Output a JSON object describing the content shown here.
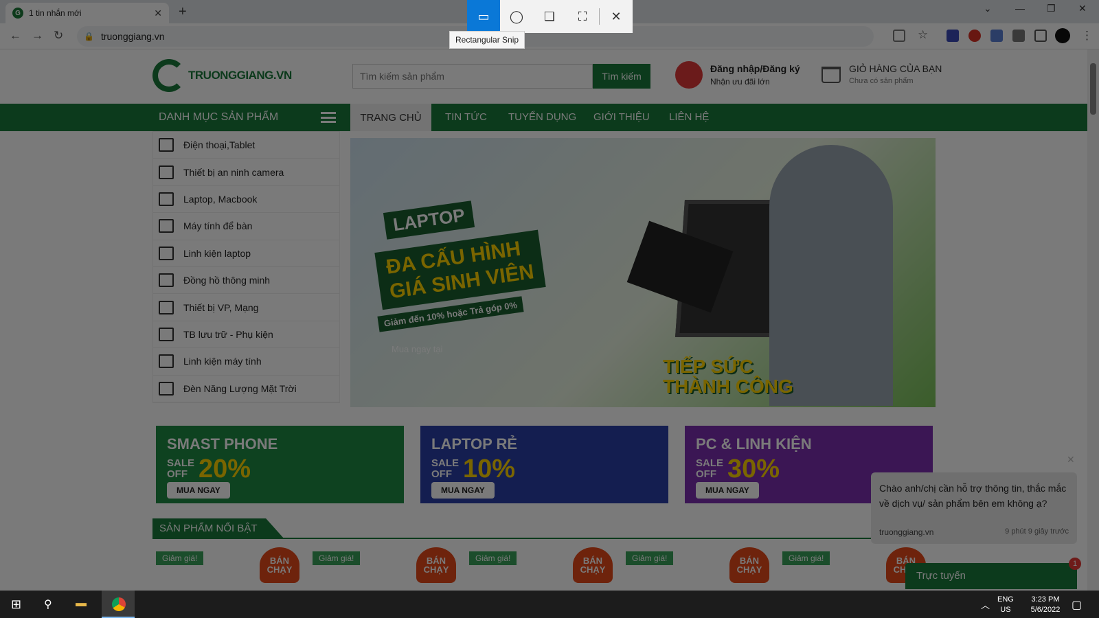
{
  "browser": {
    "tab_title": "1 tin nhắn mới",
    "tab_close": "✕",
    "new_tab": "+",
    "url": "truonggiang.vn"
  },
  "snip": {
    "tooltip": "Rectangular Snip"
  },
  "header": {
    "logo_text": "TRUONGGIANG.VN",
    "search_placeholder": "Tìm kiếm sản phẩm",
    "search_button": "Tìm kiếm",
    "login_title": "Đăng nhập/Đăng ký",
    "login_sub": "Nhận ưu đãi lớn",
    "cart_title": "GIỎ HÀNG CỦA BẠN",
    "cart_sub": "Chưa có sản phẩm"
  },
  "nav": {
    "category_title": "DANH MỤC SẢN PHẨM",
    "items": [
      "TRANG CHỦ",
      "TIN TỨC",
      "TUYỂN DỤNG",
      "GIỚI THIỆU",
      "LIÊN HỆ"
    ]
  },
  "sidebar": {
    "items": [
      {
        "label": "Điện thoại,Tablet",
        "icon": "phone-icon"
      },
      {
        "label": "Thiết bị an ninh camera",
        "icon": "camera-icon"
      },
      {
        "label": "Laptop, Macbook",
        "icon": "laptop-icon"
      },
      {
        "label": "Máy tính để bàn",
        "icon": "desktop-icon"
      },
      {
        "label": "Linh kiện laptop",
        "icon": "keyboard-icon"
      },
      {
        "label": "Đồng hồ thông minh",
        "icon": "bulb-icon"
      },
      {
        "label": "Thiết bị VP, Mạng",
        "icon": "wifi-icon"
      },
      {
        "label": "TB lưu trữ - Phụ kiện",
        "icon": "storage-icon"
      },
      {
        "label": "Linh kiện máy tính",
        "icon": "monitor-icon"
      },
      {
        "label": "Đèn Năng Lượng Mặt Trời",
        "icon": "bulb-icon"
      }
    ]
  },
  "banner": {
    "line1": "LAPTOP",
    "line2": "ĐA CẤU HÌNH",
    "line3": "GIÁ SINH VIÊN",
    "promo": "Giảm đến 10% hoặc Trả góp 0%",
    "buy_at": "Mua ngay tại",
    "slogan1": "TIẾP SỨC",
    "slogan2": "THÀNH CÔNG"
  },
  "promos": [
    {
      "title": "SMAST PHONE",
      "sale": "SALE",
      "off": "OFF",
      "percent": "20%",
      "button": "MUA NGAY",
      "color": "#1f8a43"
    },
    {
      "title": "LAPTOP RẺ",
      "sale": "SALE",
      "off": "OFF",
      "percent": "10%",
      "button": "MUA NGAY",
      "color": "#2a3fa8"
    },
    {
      "title": "PC & LINH KIỆN",
      "sale": "SALE",
      "off": "OFF",
      "percent": "30%",
      "button": "MUA NGAY",
      "color": "#7b2fb0"
    }
  ],
  "featured": {
    "title": "SẢN PHẨM NỔI BẬT",
    "sale_badge": "Giảm giá!",
    "hot_badge": "BÁN CHẠY"
  },
  "chat": {
    "message": "Chào anh/chị cần hỗ trợ thông tin, thắc mắc về dịch vụ/ sản phẩm bên em không ạ?",
    "sender": "truonggiang.vn",
    "time": "9 phút 9 giây trước",
    "online_label": "Trực tuyến",
    "unread": "1"
  },
  "taskbar": {
    "lang": "ENG",
    "region": "US",
    "time": "3:23 PM",
    "date": "5/6/2022"
  }
}
